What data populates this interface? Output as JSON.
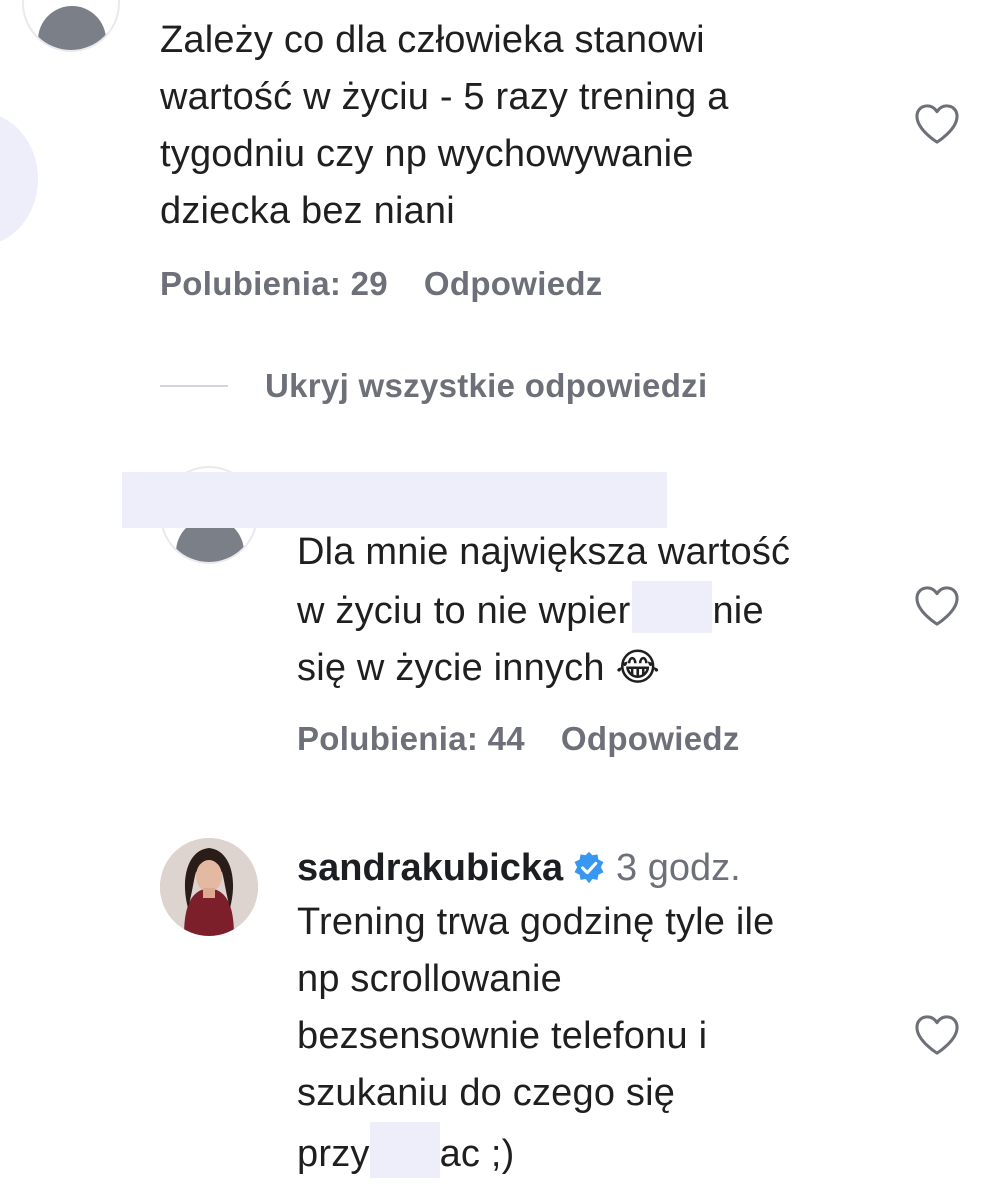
{
  "colors": {
    "meta_text": "#6e7079",
    "body_text": "#1f1f1f",
    "verified_badge": "#3897f0",
    "redaction": "#eeeefb"
  },
  "comments": [
    {
      "text_lines": [
        "Zależy co dla człowieka stanowi",
        "wartość w życiu - 5 razy trening a",
        "tygodniu czy np wychowywanie",
        "dziecka bez niani"
      ],
      "likes_label": "Polubienia: 29",
      "reply_label": "Odpowiedz",
      "icon": "heart-outline-icon"
    },
    {
      "text_line1": "Dla mnie największa wartość",
      "text_line2a": "w życiu to nie wpier",
      "text_line2b": "nie",
      "text_line3": "się w życie innych",
      "emoji": "😂",
      "likes_label": "Polubienia: 44",
      "reply_label": "Odpowiedz",
      "icon": "heart-outline-icon"
    },
    {
      "username": "sandrakubicka",
      "timestamp": "3 godz.",
      "verified_icon": "verified-badge-icon",
      "text_lines": [
        "Trening trwa godzinę tyle ile",
        "np scrollowanie",
        "bezsensownie telefonu i",
        "szukaniu do czego się"
      ],
      "last_line_start": "przy",
      "last_line_end": "ac ;)",
      "icon": "heart-outline-icon"
    }
  ],
  "hide_replies_label": "Ukryj wszystkie odpowiedzi"
}
